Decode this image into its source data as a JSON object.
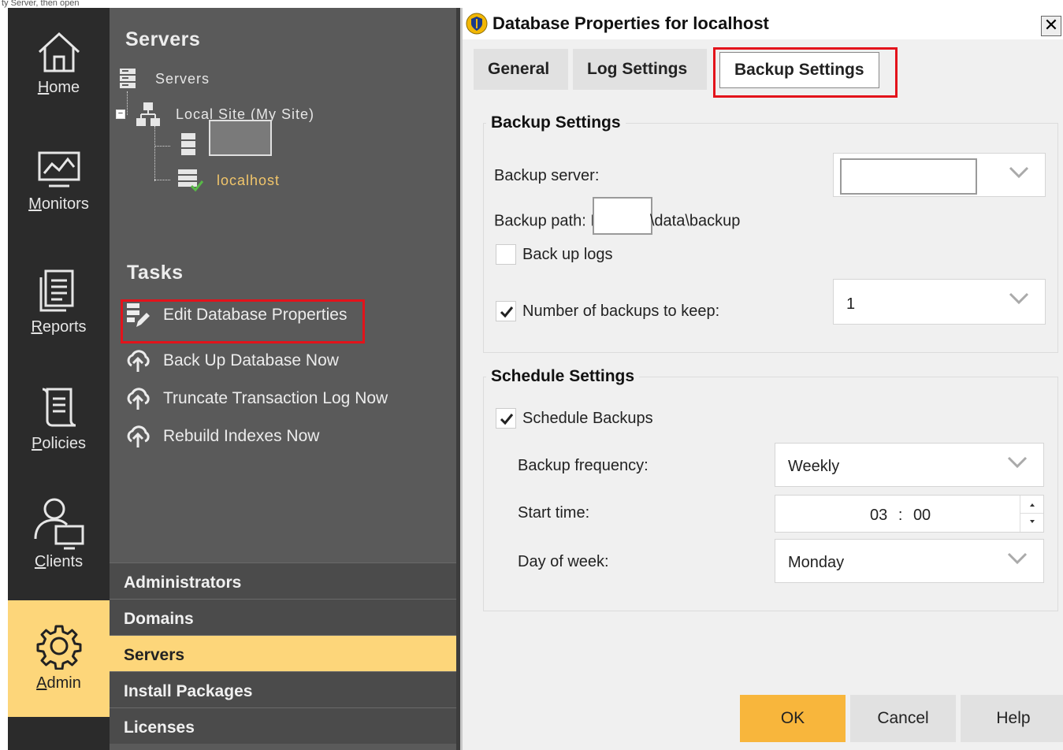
{
  "caption": "ty Server, then open",
  "nav": {
    "items": [
      {
        "label_first": "H",
        "label_rest": "ome",
        "icon": "home-icon"
      },
      {
        "label_first": "M",
        "label_rest": "onitors",
        "icon": "monitor-chart-icon"
      },
      {
        "label_first": "R",
        "label_rest": "eports",
        "icon": "reports-icon"
      },
      {
        "label_first": "P",
        "label_rest": "olicies",
        "icon": "policy-scroll-icon"
      },
      {
        "label_first": "C",
        "label_rest": "lients",
        "icon": "client-user-icon"
      },
      {
        "label_first": "A",
        "label_rest": "dmin",
        "icon": "gear-icon",
        "active": true
      }
    ]
  },
  "servers": {
    "title": "Servers",
    "tree": {
      "root_label": "Servers",
      "site_label": "Local Site (My Site)",
      "host_label": "localhost"
    }
  },
  "tasks": {
    "title": "Tasks",
    "items": [
      "Edit Database Properties",
      "Back Up Database Now",
      "Truncate Transaction Log Now",
      "Rebuild Indexes Now"
    ]
  },
  "accordion": [
    "Administrators",
    "Domains",
    "Servers",
    "Install Packages",
    "Licenses"
  ],
  "accordion_active": "Servers",
  "dialog": {
    "title": "Database Properties for localhost",
    "close": "✕",
    "tabs": [
      "General",
      "Log Settings",
      "Backup Settings"
    ],
    "selected_tab": "Backup Settings",
    "backup": {
      "group_title": "Backup Settings",
      "server_label": "Backup server:",
      "server_value": "",
      "path_label": "Backup path: I",
      "path_suffix": "\\data\\backup",
      "backup_logs_label": "Back up logs",
      "backup_logs_checked": false,
      "keep_label": "Number of backups to keep:",
      "keep_checked": true,
      "keep_value": "1"
    },
    "schedule": {
      "group_title": "Schedule Settings",
      "schedule_label": "Schedule Backups",
      "schedule_checked": true,
      "frequency_label": "Backup frequency:",
      "frequency_value": "Weekly",
      "start_label": "Start time:",
      "start_hour": "03",
      "start_sep": ":",
      "start_min": "00",
      "day_label": "Day of week:",
      "day_value": "Monday"
    },
    "buttons": {
      "ok": "OK",
      "cancel": "Cancel",
      "help": "Help"
    }
  },
  "colors": {
    "accent": "#fdd67a",
    "primary_button": "#f8b63c",
    "highlight_box": "#e3131b",
    "nav_bg": "#2b2b2b",
    "pane_bg": "#5a5a5a"
  }
}
